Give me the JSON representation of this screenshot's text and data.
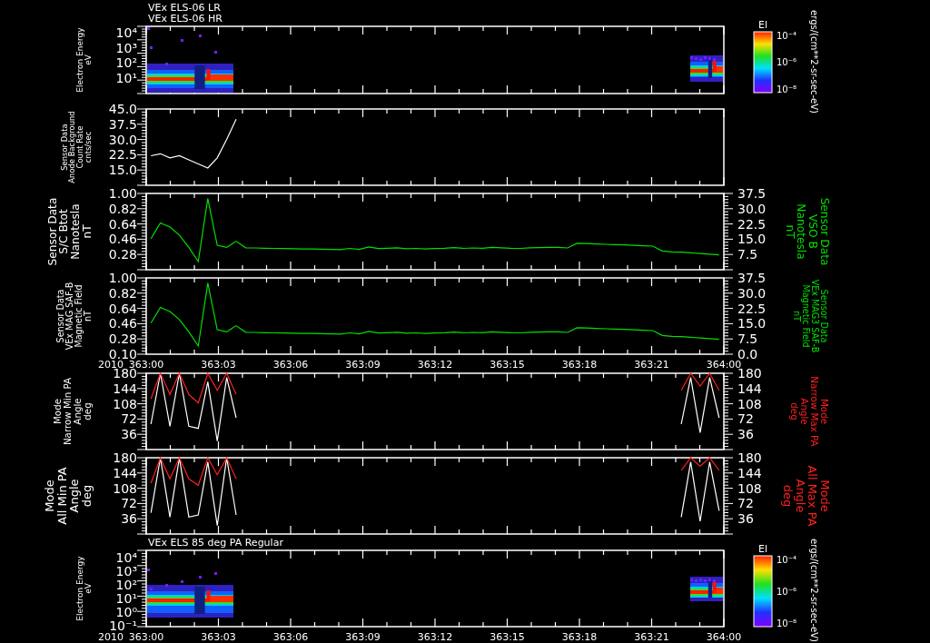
{
  "panels": [
    {
      "kind": "spectrogram",
      "titles": [
        "VEx ELS-06 LR",
        "VEx ELS-06 HR"
      ],
      "left_label": [
        "Electron Energy",
        "eV"
      ],
      "left_ticks": [
        "10⁴",
        "10³",
        "10²",
        "10¹"
      ],
      "colorbar": {
        "title": "El",
        "ticks": [
          "10⁻⁴",
          "10⁻⁶",
          "10⁻⁸"
        ]
      },
      "unit_label": "ergs/(cm**2-sr-sec-eV)"
    },
    {
      "kind": "line",
      "left_label": [
        "Sensor Data",
        "Anode Background",
        "Count Rate",
        "cnts/sec"
      ],
      "chart_data": {
        "type": "line",
        "ylim": [
          7.5,
          45
        ],
        "yticks": [
          {
            "value": 45,
            "label": "45.0"
          },
          {
            "value": 37.5,
            "label": "37.5"
          },
          {
            "value": 30,
            "label": "30.0"
          },
          {
            "value": 22.5,
            "label": "22.5"
          },
          {
            "value": 15,
            "label": "15.0"
          }
        ],
        "categories": [
          null,
          null,
          null,
          null,
          null,
          null,
          null,
          null,
          null,
          null
        ],
        "series": [
          {
            "color": "#ffffff",
            "values": [
              22,
              23,
              21,
              22,
              20,
              18,
              16,
              21,
              30,
              40
            ]
          }
        ]
      }
    },
    {
      "kind": "line",
      "left_label": [
        "Sensor Data",
        "S/C Btot",
        "Nanotesla",
        "nT"
      ],
      "left_ticks": [
        "1.00",
        "0.82",
        "0.64",
        "0.46",
        "0.28"
      ],
      "right_label": [
        "Sensor Data",
        "VSO B",
        "Nanotesla",
        "nT"
      ],
      "chart_data": {
        "type": "line",
        "ylim": [
          0,
          37.5
        ],
        "yticks": [
          {
            "value": 37.5,
            "label": "37.5"
          },
          {
            "value": 30,
            "label": "30.0"
          },
          {
            "value": 22.5,
            "label": "22.5"
          },
          {
            "value": 15,
            "label": "15.0"
          },
          {
            "value": 7.5,
            "label": "7.5"
          }
        ],
        "categories": [
          null,
          null,
          null,
          null,
          null,
          null,
          null,
          null,
          null,
          null,
          null,
          null,
          null,
          null,
          null,
          null,
          null,
          null,
          null,
          null,
          null,
          null,
          null,
          null,
          null,
          null,
          null,
          null,
          null,
          null,
          null,
          null,
          null,
          null,
          null,
          null,
          null,
          null,
          null,
          null,
          null,
          null,
          null,
          null,
          null,
          null,
          null,
          null,
          null,
          null,
          null,
          null,
          null,
          null,
          null,
          null,
          null,
          null,
          null,
          null,
          null
        ],
        "series": [
          {
            "color": "#00e000",
            "values": [
              15.3,
              23,
              21,
              17,
              11,
              4,
              35,
              12,
              11,
              14,
              10.8,
              10.7,
              10.6,
              10.5,
              10.4,
              10.3,
              10.2,
              10.2,
              10.1,
              10.0,
              9.9,
              10.5,
              10.0,
              11.2,
              10.4,
              10.6,
              10.8,
              10.3,
              10.5,
              10.2,
              10.4,
              10.6,
              10.9,
              10.5,
              10.7,
              10.6,
              11.0,
              10.8,
              10.6,
              10.5,
              10.8,
              10.9,
              11.0,
              11.0,
              10.7,
              13.0,
              12.9,
              12.7,
              12.5,
              12.3,
              12.2,
              12.0,
              11.8,
              11.6,
              9.2,
              8.8,
              8.6,
              8.3,
              8.0,
              7.7,
              7.3
            ]
          }
        ]
      }
    },
    {
      "kind": "line",
      "left_label": [
        "Sensor Data",
        "VEx MAG SAF-B",
        "Magnetic Field",
        "nT"
      ],
      "left_ticks": [
        "1.00",
        "0.82",
        "0.64",
        "0.46",
        "0.28",
        "0.10"
      ],
      "right_label": [
        "Sensor Data",
        "VEx MAG3 SAF-B",
        "Magnetic Field",
        "nT"
      ],
      "chart_data": {
        "type": "line",
        "ylim": [
          0,
          37.5
        ],
        "yticks": [
          {
            "value": 37.5,
            "label": "37.5"
          },
          {
            "value": 30,
            "label": "30.0"
          },
          {
            "value": 22.5,
            "label": "22.5"
          },
          {
            "value": 15,
            "label": "15.0"
          },
          {
            "value": 7.5,
            "label": "7.5"
          },
          {
            "value": 0,
            "label": "0.0"
          }
        ],
        "categories": [
          null,
          null,
          null,
          null,
          null,
          null,
          null,
          null,
          null,
          null,
          null,
          null,
          null,
          null,
          null,
          null,
          null,
          null,
          null,
          null,
          null,
          null,
          null,
          null,
          null,
          null,
          null,
          null,
          null,
          null,
          null,
          null,
          null,
          null,
          null,
          null,
          null,
          null,
          null,
          null,
          null,
          null,
          null,
          null,
          null,
          null,
          null,
          null,
          null,
          null,
          null,
          null,
          null,
          null,
          null,
          null,
          null,
          null,
          null,
          null,
          null
        ],
        "series": [
          {
            "color": "#00e000",
            "values": [
              15.3,
              23,
              21,
              17,
              11,
              4,
              35,
              12,
              11,
              14,
              10.8,
              10.7,
              10.6,
              10.5,
              10.4,
              10.3,
              10.2,
              10.2,
              10.1,
              10.0,
              9.9,
              10.5,
              10.0,
              11.2,
              10.4,
              10.6,
              10.8,
              10.3,
              10.5,
              10.2,
              10.4,
              10.6,
              10.9,
              10.5,
              10.7,
              10.6,
              11.0,
              10.8,
              10.6,
              10.5,
              10.8,
              10.9,
              11.0,
              11.0,
              10.7,
              13.0,
              12.9,
              12.7,
              12.5,
              12.3,
              12.2,
              12.0,
              11.8,
              11.6,
              9.2,
              8.8,
              8.6,
              8.3,
              8.0,
              7.7,
              7.3
            ]
          }
        ]
      },
      "time_axis": {
        "year": "2010",
        "labels": [
          "363:00",
          "363:03",
          "363:06",
          "363:09",
          "363:12",
          "363:15",
          "363:18",
          "363:21",
          "364:00"
        ]
      }
    },
    {
      "kind": "line",
      "left_label": [
        "Mode",
        "Narrow Min PA",
        "Angle",
        "deg"
      ],
      "right_label": [
        "Mode",
        "Narrow Max PA",
        "Angle",
        "deg"
      ],
      "right_ticks": [
        "180",
        "144",
        "108",
        "72",
        "36"
      ],
      "chart_data": {
        "type": "line",
        "ylim": [
          0,
          180
        ],
        "yticks": [
          {
            "value": 180,
            "label": "180"
          },
          {
            "value": 144,
            "label": "144"
          },
          {
            "value": 108,
            "label": "108"
          },
          {
            "value": 72,
            "label": "72"
          },
          {
            "value": 36,
            "label": "36"
          }
        ],
        "categories": [
          null,
          null,
          null,
          null,
          null,
          null,
          null,
          null,
          null,
          null,
          null,
          null,
          null,
          null,
          null,
          null,
          null,
          null,
          null,
          null,
          null,
          null,
          null,
          null,
          null,
          null,
          null,
          null,
          null,
          null,
          null,
          null,
          null,
          null,
          null,
          null,
          null,
          null,
          null,
          null,
          null,
          null,
          null,
          null,
          null,
          null,
          null,
          null,
          null,
          null,
          null,
          null,
          null,
          null,
          null,
          null,
          null,
          null,
          null,
          null,
          null
        ],
        "series": [
          {
            "color": "#ffffff",
            "values": [
              60,
              180,
              55,
              180,
              55,
              50,
              160,
              20,
              170,
              75,
              null,
              null,
              null,
              null,
              null,
              null,
              null,
              null,
              null,
              null,
              null,
              null,
              null,
              null,
              null,
              null,
              null,
              null,
              null,
              null,
              null,
              null,
              null,
              null,
              null,
              null,
              null,
              null,
              null,
              null,
              null,
              null,
              null,
              null,
              null,
              null,
              null,
              null,
              null,
              null,
              null,
              null,
              null,
              null,
              null,
              null,
              60,
              170,
              40,
              170,
              75
            ]
          },
          {
            "color": "#ff2020",
            "values": [
              120,
              180,
              130,
              180,
              130,
              110,
              180,
              140,
              180,
              130,
              null,
              null,
              null,
              null,
              null,
              null,
              null,
              null,
              null,
              null,
              null,
              null,
              null,
              null,
              null,
              null,
              null,
              null,
              null,
              null,
              null,
              null,
              null,
              null,
              null,
              null,
              null,
              null,
              null,
              null,
              null,
              null,
              null,
              null,
              null,
              null,
              null,
              null,
              null,
              null,
              null,
              null,
              null,
              null,
              null,
              null,
              140,
              180,
              150,
              180,
              140
            ]
          }
        ]
      }
    },
    {
      "kind": "line",
      "left_label": [
        "Mode",
        "All Min PA",
        "Angle",
        "deg"
      ],
      "right_label": [
        "Mode",
        "All Max PA",
        "Angle",
        "deg"
      ],
      "right_ticks": [
        "180",
        "144",
        "108",
        "72",
        "36"
      ],
      "chart_data": {
        "type": "line",
        "ylim": [
          0,
          180
        ],
        "yticks": [
          {
            "value": 180,
            "label": "180"
          },
          {
            "value": 144,
            "label": "144"
          },
          {
            "value": 108,
            "label": "108"
          },
          {
            "value": 72,
            "label": "72"
          },
          {
            "value": 36,
            "label": "36"
          }
        ],
        "categories": [
          null,
          null,
          null,
          null,
          null,
          null,
          null,
          null,
          null,
          null,
          null,
          null,
          null,
          null,
          null,
          null,
          null,
          null,
          null,
          null,
          null,
          null,
          null,
          null,
          null,
          null,
          null,
          null,
          null,
          null,
          null,
          null,
          null,
          null,
          null,
          null,
          null,
          null,
          null,
          null,
          null,
          null,
          null,
          null,
          null,
          null,
          null,
          null,
          null,
          null,
          null,
          null,
          null,
          null,
          null,
          null,
          null,
          null,
          null,
          null,
          null
        ],
        "series": [
          {
            "color": "#ffffff",
            "values": [
              50,
              180,
              40,
              180,
              40,
              45,
              170,
              20,
              180,
              45,
              null,
              null,
              null,
              null,
              null,
              null,
              null,
              null,
              null,
              null,
              null,
              null,
              null,
              null,
              null,
              null,
              null,
              null,
              null,
              null,
              null,
              null,
              null,
              null,
              null,
              null,
              null,
              null,
              null,
              null,
              null,
              null,
              null,
              null,
              null,
              null,
              null,
              null,
              null,
              null,
              null,
              null,
              null,
              null,
              null,
              null,
              40,
              170,
              30,
              170,
              55
            ]
          },
          {
            "color": "#ff2020",
            "values": [
              120,
              180,
              130,
              180,
              130,
              115,
              180,
              140,
              180,
              130,
              null,
              null,
              null,
              null,
              null,
              null,
              null,
              null,
              null,
              null,
              null,
              null,
              null,
              null,
              null,
              null,
              null,
              null,
              null,
              null,
              null,
              null,
              null,
              null,
              null,
              null,
              null,
              null,
              null,
              null,
              null,
              null,
              null,
              null,
              null,
              null,
              null,
              null,
              null,
              null,
              null,
              null,
              null,
              null,
              null,
              null,
              150,
              180,
              160,
              180,
              150
            ]
          }
        ]
      }
    },
    {
      "kind": "spectrogram",
      "titles": [
        "VEx ELS 85 deg PA Regular"
      ],
      "left_label": [
        "Electron Energy",
        "eV"
      ],
      "left_ticks": [
        "10⁴",
        "10³",
        "10²",
        "10¹",
        "10⁰",
        "10⁻¹"
      ],
      "colorbar": {
        "title": "El",
        "ticks": [
          "10⁻⁴",
          "10⁻⁶",
          "10⁻⁸"
        ]
      },
      "unit_label": "ergs/(cm**2-sr-sec-eV)",
      "time_axis": {
        "year": "2010",
        "labels": [
          "363:00",
          "363:03",
          "363:06",
          "363:09",
          "363:12",
          "363:15",
          "363:18",
          "363:21",
          "364:00"
        ]
      }
    }
  ]
}
